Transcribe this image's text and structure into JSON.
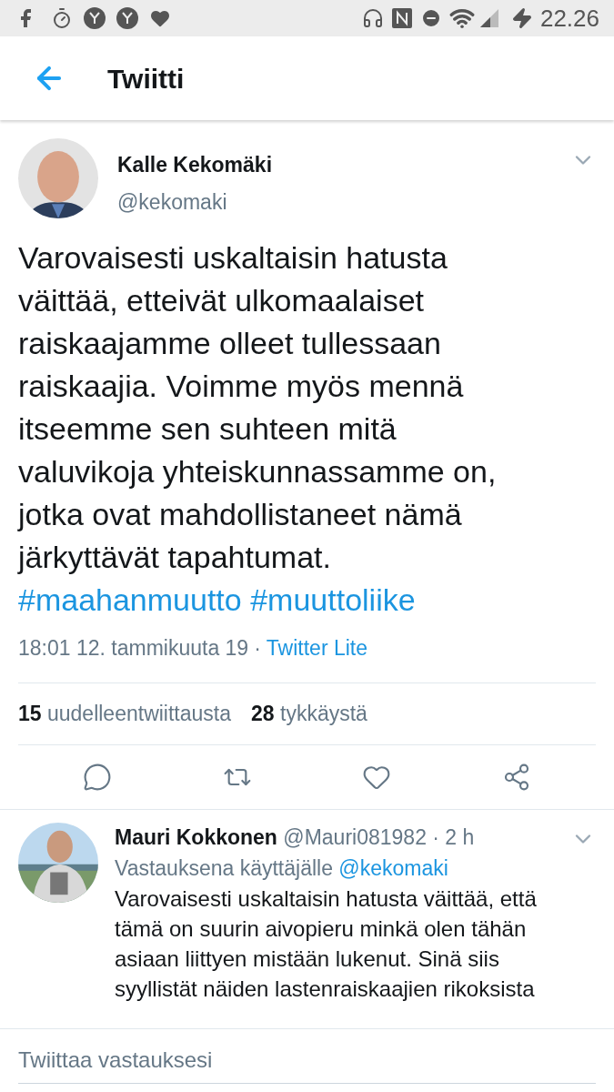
{
  "status_bar": {
    "time": "22.26"
  },
  "header": {
    "title": "Twiitti"
  },
  "tweet": {
    "author": {
      "name": "Kalle Kekomäki",
      "handle": "@kekomaki"
    },
    "text": "Varovaisesti uskaltaisin hatusta väittää, etteivät ulkomaalaiset raiskaajamme olleet tullessaan raiskaajia. Voimme myös mennä itseemme sen suhteen mitä valuvikoja yhteiskunnassamme on, jotka ovat mahdollistaneet nämä järkyttävät tapahtumat.",
    "hashtags": [
      "#maahanmuutto",
      "#muuttoliike"
    ],
    "timestamp": "18:01 12. tammikuuta 19",
    "separator": "·",
    "source": "Twitter Lite",
    "stats": [
      {
        "count": "15",
        "label": "uudelleentwiittausta"
      },
      {
        "count": "28",
        "label": "tykkäystä"
      }
    ]
  },
  "replies": [
    {
      "name": "Mauri Kokkonen",
      "handle": "@Mauri081982",
      "time": "· 2 h",
      "reply_to_label": "Vastauksena käyttäjälle",
      "reply_to": "@kekomaki",
      "text": "Varovaisesti uskaltaisin hatusta väittää, että tämä on suurin aivopieru minkä olen tähän asiaan liittyen mistään lukenut. Sinä siis syyllistät näiden lastenraiskaajien rikoksista"
    }
  ],
  "compose": {
    "placeholder": "Twiittaa vastauksesi"
  }
}
